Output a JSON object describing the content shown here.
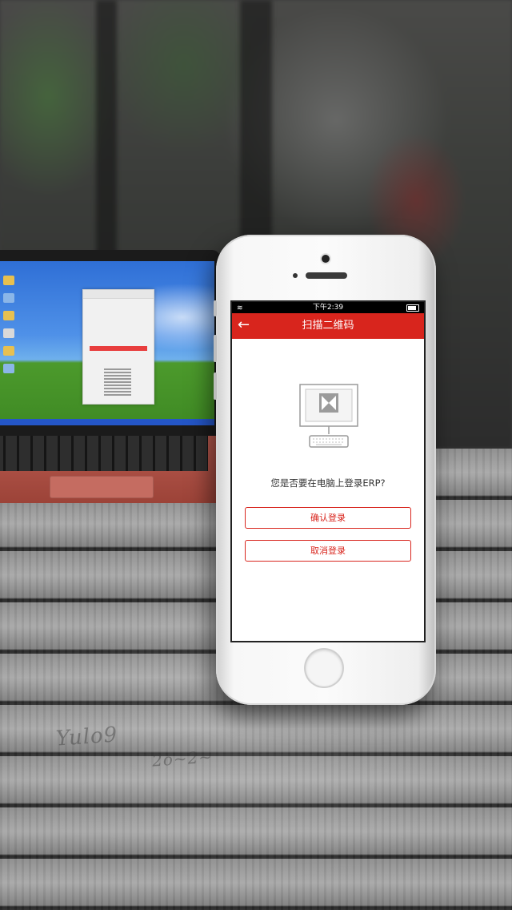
{
  "status_bar": {
    "time": "下午2:39",
    "wifi_icon": "wifi-icon",
    "battery_icon": "battery-icon"
  },
  "nav": {
    "title": "扫描二维码",
    "back_icon": "back-arrow-icon"
  },
  "main": {
    "illustration_icon": "computer-icon",
    "question": "您是否要在电脑上登录ERP?",
    "confirm_label": "确认登录",
    "cancel_label": "取消登录"
  },
  "colors": {
    "accent": "#d8251d",
    "screen_bg": "#ffffff",
    "status_bar_bg": "#000000"
  }
}
